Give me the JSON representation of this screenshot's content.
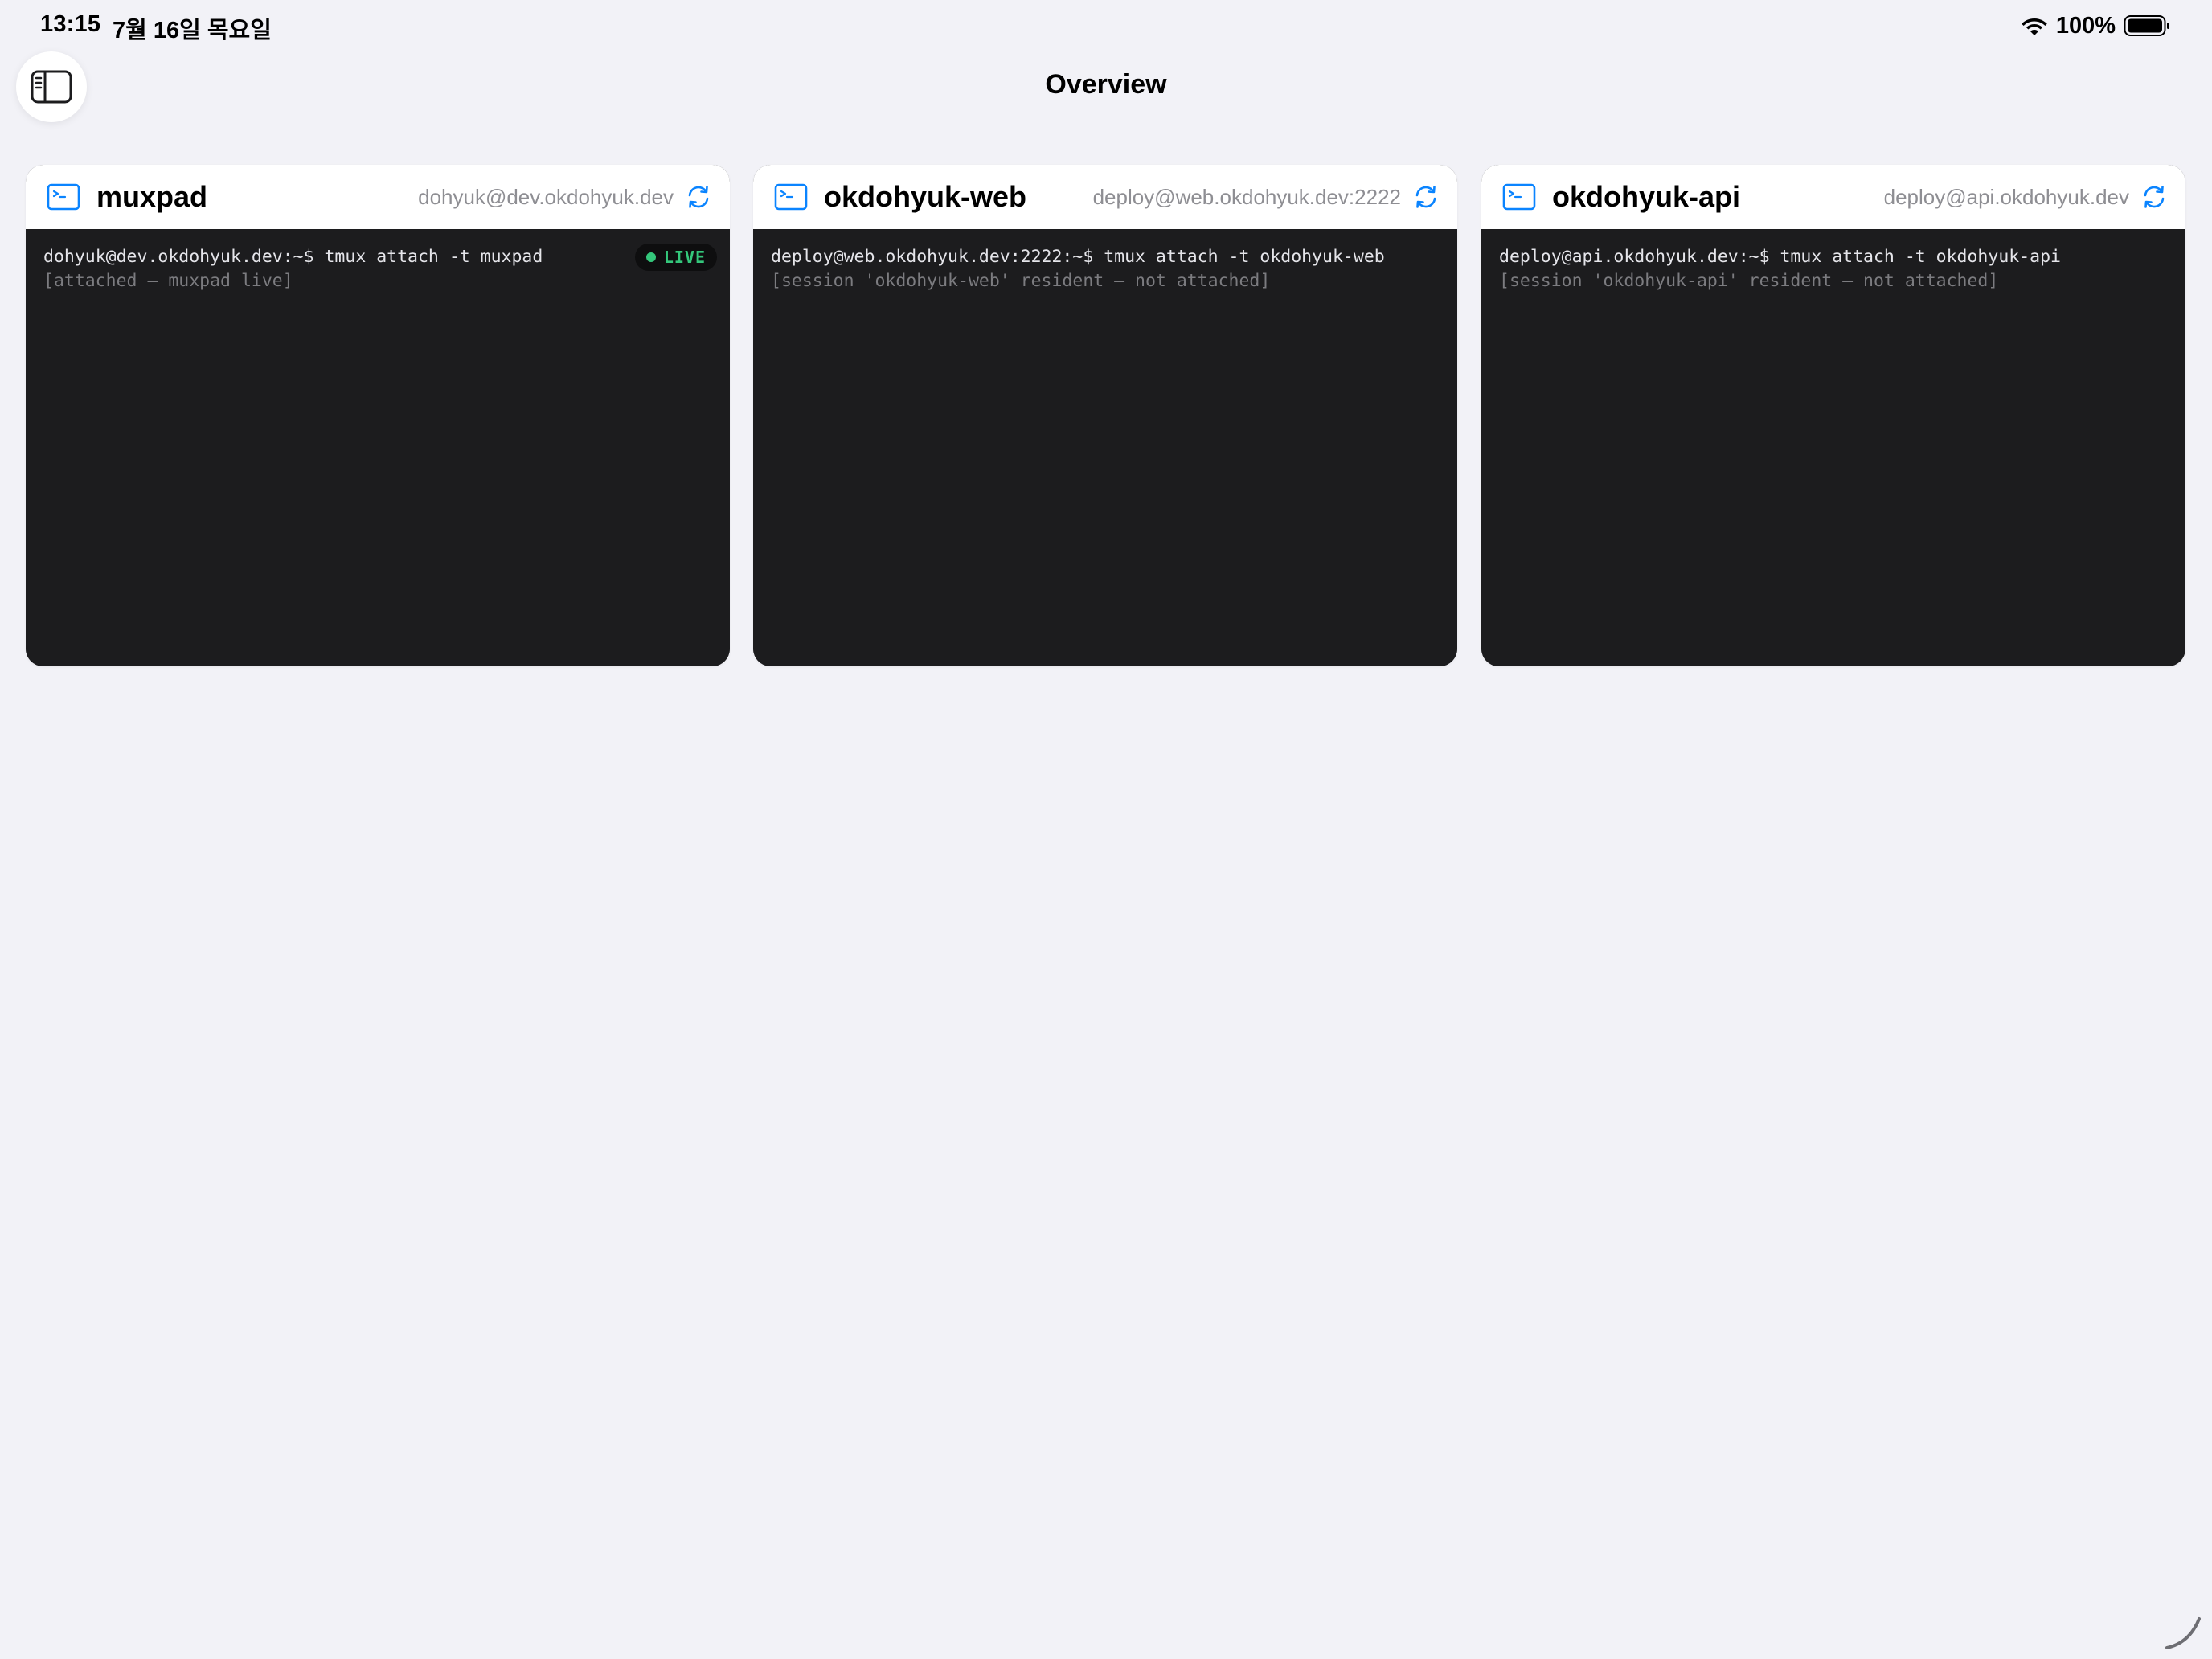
{
  "status_bar": {
    "time": "13:15",
    "date": "7월 16일 목요일",
    "battery": "100%"
  },
  "nav": {
    "title": "Overview"
  },
  "sessions": [
    {
      "name": "muxpad",
      "host": "dohyuk@dev.okdohyuk.dev",
      "command": "dohyuk@dev.okdohyuk.dev:~$ tmux attach -t muxpad",
      "status": "[attached — muxpad live]",
      "badge": "LIVE"
    },
    {
      "name": "okdohyuk-web",
      "host": "deploy@web.okdohyuk.dev:2222",
      "command": "deploy@web.okdohyuk.dev:2222:~$ tmux attach -t okdohyuk-web",
      "status": "[session 'okdohyuk-web' resident — not attached]"
    },
    {
      "name": "okdohyuk-api",
      "host": "deploy@api.okdohyuk.dev",
      "command": "deploy@api.okdohyuk.dev:~$ tmux attach -t okdohyuk-api",
      "status": "[session 'okdohyuk-api' resident — not attached]"
    }
  ],
  "colors": {
    "accent": "#0a84ff",
    "live": "#34c77b",
    "background": "#f2f2f7",
    "terminal_bg": "#1c1c1e"
  },
  "icons": {
    "sidebar_toggle": "sidebar-left-icon",
    "session": "terminal-icon",
    "refresh": "refresh-icon",
    "wifi": "wifi-icon",
    "battery": "battery-icon"
  }
}
